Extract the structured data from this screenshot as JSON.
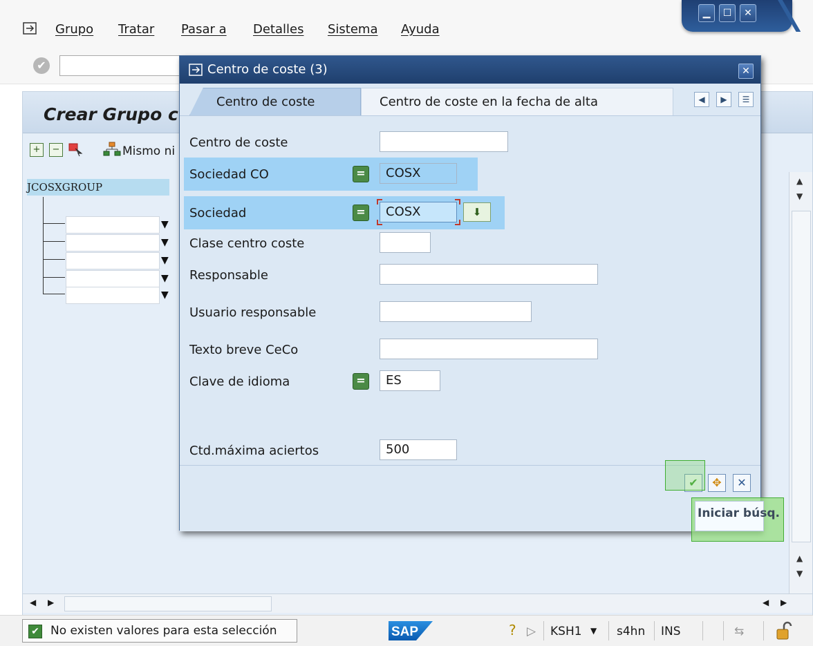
{
  "menubar": {
    "items": [
      "Grupo",
      "Tratar",
      "Pasar a",
      "Detalles",
      "Sistema",
      "Ayuda"
    ]
  },
  "main": {
    "title": "Crear Grupo c",
    "toolbar_same_level": "Mismo ni",
    "tree_root": "JCOSXGROUP"
  },
  "dialog": {
    "title": "Centro de coste (3)",
    "tabs": [
      {
        "label": "Centro de coste",
        "active": true
      },
      {
        "label": "Centro de coste en la fecha de alta",
        "active": false
      }
    ],
    "fields": [
      {
        "label": "Centro de coste",
        "value": ""
      },
      {
        "label": "Sociedad CO",
        "value": "COSX"
      },
      {
        "label": "Sociedad",
        "value": "COSX"
      },
      {
        "label": "Clase centro coste",
        "value": ""
      },
      {
        "label": "Responsable",
        "value": ""
      },
      {
        "label": "Usuario responsable",
        "value": ""
      },
      {
        "label": "Texto breve CeCo",
        "value": ""
      },
      {
        "label": "Clave de idioma",
        "value": "ES"
      },
      {
        "label": "Ctd.máxima aciertos",
        "value": "500"
      }
    ],
    "tooltip": "Iniciar búsq."
  },
  "statusbar": {
    "message": "No existen valores para esta selección",
    "transaction": "KSH1",
    "system": "s4hn",
    "mode": "INS",
    "logo": "SAP"
  },
  "colors": {
    "dialog_titlebar": "#30578d",
    "field_highlight": "#9fd2f5",
    "accent_green": "#4b8a46",
    "tab_active": "#b7cfe9"
  },
  "icons": [
    "menu-icon",
    "check-icon",
    "window-minimize-icon",
    "window-maximize-icon",
    "window-close-icon",
    "expand-icon",
    "collapse-icon",
    "select-icon",
    "hierarchy-icon",
    "dialog-menu-icon",
    "close-icon",
    "chevron-left-icon",
    "chevron-right-icon",
    "tab-list-icon",
    "equal-icon",
    "value-help-icon",
    "continue-check-icon",
    "multiple-selection-icon",
    "cancel-icon",
    "help-icon",
    "play-icon",
    "lock-icon"
  ]
}
